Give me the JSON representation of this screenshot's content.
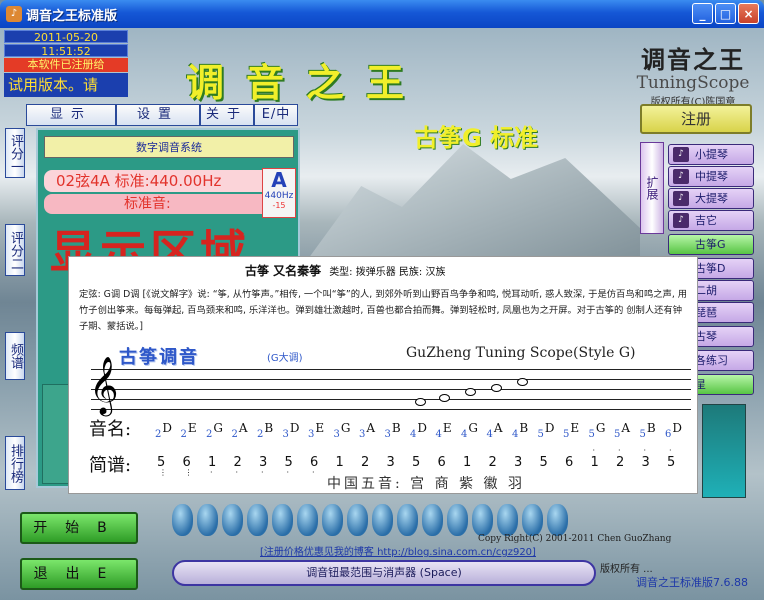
{
  "window": {
    "title": "调音之王标准版",
    "buttons": {
      "minimize": "_",
      "maximize": "□",
      "close": "×"
    }
  },
  "info": {
    "date": "2011-05-20",
    "time": "11:51:52",
    "register_notice": "本软件已注册给",
    "trial": "试用版本。请"
  },
  "header": {
    "big_title": "调音之王"
  },
  "logo": {
    "cn": "调音之王",
    "en": "TuningScope",
    "copyright": "版权所有(C)陈国章"
  },
  "tabs": [
    {
      "label": "显示"
    },
    {
      "label": "设置"
    },
    {
      "label": "关于"
    },
    {
      "label": "E/中"
    }
  ],
  "mode_title": "古筝G 标准",
  "register_button": "注册",
  "side_buttons": [
    "评分一",
    "评分二",
    "频谱",
    "排行榜"
  ],
  "display": {
    "header": "数字调音系统",
    "string_line": "02弦4A 标准:440.00Hz",
    "std_line": "标准音:",
    "note": "A",
    "note_hz": "440Hz",
    "note_cents": "-15",
    "area_text": "显示区域"
  },
  "expand_label": "扩展",
  "instruments": [
    {
      "label": "小提琴",
      "style": "purple"
    },
    {
      "label": "中提琴",
      "style": "purple"
    },
    {
      "label": "大提琴",
      "style": "purple"
    },
    {
      "label": "吉它",
      "style": "purple"
    },
    {
      "label": "古筝G",
      "style": "green"
    },
    {
      "label": "古筝D",
      "style": "purple"
    },
    {
      "label": "二胡",
      "style": "purple"
    },
    {
      "label": "琵琶",
      "style": "purple"
    },
    {
      "label": "古琴",
      "style": "purple"
    },
    {
      "label": "各练习",
      "style": "purple"
    },
    {
      "label": "星",
      "style": "green"
    }
  ],
  "staff": {
    "title": "古筝 又名秦筝",
    "type_text": "类型: 拨弹乐器 民族: 汉族",
    "definition": "定弦: G调 D调 [《说文解字》说: “筝, 从竹筝声。”相传, 一个叫“筝”的人, 到郊外听到山野百鸟争争和鸣, 悦耳动听, 惑人致深, 于是仿百鸟和鸣之声, 用竹子创出筝来。每每弹起, 百鸟颈来和鸣, 乐洋洋也。弹到雄壮激越时, 百兽也都合拍而舞。弹到轻松时, 凤凰也为之开屏。对于古筝的 创制人还有钟子期、蒙括说。]",
    "heading": "古筝调音",
    "key": "(G大调)",
    "english": "GuZheng Tuning Scope(Style G)",
    "name_label": "音名:",
    "jianpu_label": "简谱:",
    "note_names": [
      {
        "o": "2",
        "n": "D"
      },
      {
        "o": "2",
        "n": "E"
      },
      {
        "o": "2",
        "n": "G"
      },
      {
        "o": "2",
        "n": "A"
      },
      {
        "o": "2",
        "n": "B"
      },
      {
        "o": "3",
        "n": "D"
      },
      {
        "o": "3",
        "n": "E"
      },
      {
        "o": "3",
        "n": "G"
      },
      {
        "o": "3",
        "n": "A"
      },
      {
        "o": "3",
        "n": "B"
      },
      {
        "o": "4",
        "n": "D"
      },
      {
        "o": "4",
        "n": "E"
      },
      {
        "o": "4",
        "n": "G"
      },
      {
        "o": "4",
        "n": "A"
      },
      {
        "o": "4",
        "n": "B"
      },
      {
        "o": "5",
        "n": "D"
      },
      {
        "o": "5",
        "n": "E"
      },
      {
        "o": "5",
        "n": "G"
      },
      {
        "o": "5",
        "n": "A"
      },
      {
        "o": "5",
        "n": "B"
      },
      {
        "o": "6",
        "n": "D"
      }
    ],
    "jianpu": [
      "5",
      "6",
      "1",
      "2",
      "3",
      "5",
      "6",
      "1",
      "2",
      "3",
      "5",
      "6",
      "1",
      "2",
      "3",
      "5",
      "6",
      "1",
      "2",
      "3",
      "5"
    ],
    "pentatonic": "中国五音: 宫 商 紫 徽 羽"
  },
  "bottom": {
    "start": "开始B",
    "exit": "退出E",
    "blog": "[注册价格优惠见我的博客 http://blog.sina.com.cn/cgz920]",
    "copyright": "Copy Right(C) 2001-2011 Chen GuoZhang",
    "range_bar": "调音钮最范围与消声器 (Space)",
    "right_text": "版权所有 ...",
    "version": "调音之王标准版7.6.88"
  }
}
